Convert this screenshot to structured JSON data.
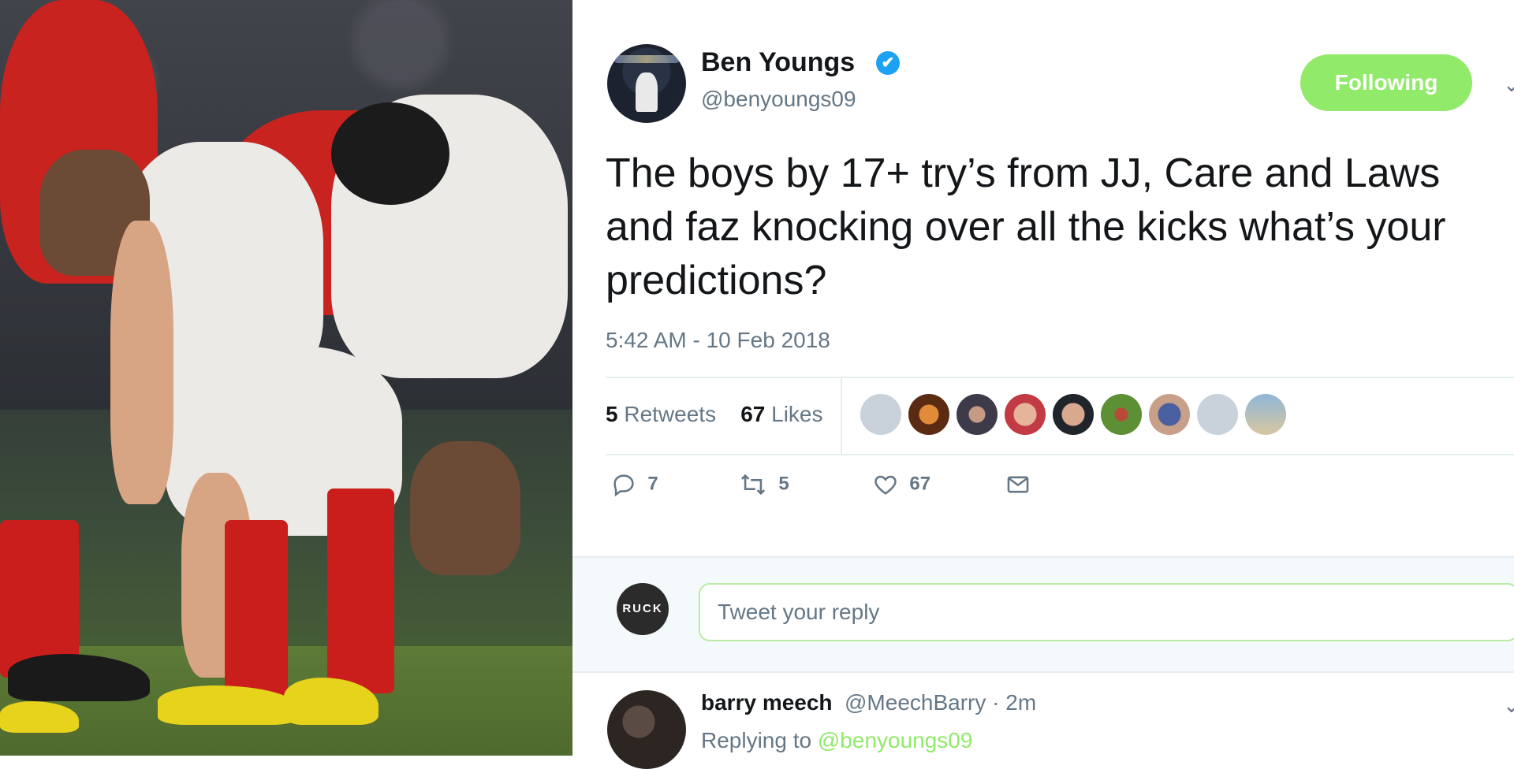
{
  "tweet": {
    "author_name": "Ben Youngs",
    "verified_mark": "✔",
    "handle": "@benyoungs09",
    "follow_button": "Following",
    "text": "The boys by 17+ try’s from JJ, Care and Laws and faz knocking over all the kicks what’s your predictions?",
    "timestamp": "5:42 AM - 10 Feb 2018",
    "retweets_count": "5",
    "retweets_label": "Retweets",
    "likes_count": "67",
    "likes_label": "Likes",
    "actions": {
      "reply_count": "7",
      "retweet_count": "5",
      "like_count": "67"
    }
  },
  "reply_box": {
    "avatar_text": "RUCK",
    "placeholder": "Tweet your reply"
  },
  "first_reply": {
    "name": "barry meech",
    "handle": "@MeechBarry · 2m",
    "replying_prefix": "Replying to",
    "replying_to": "@benyoungs09"
  },
  "colors": {
    "follow_green": "#91ea6a",
    "verified_blue": "#1da1f2",
    "muted_text": "#657786",
    "main_text": "#14171a"
  },
  "icons": [
    "verified-badge-icon",
    "chevron-down-icon",
    "reply-icon",
    "retweet-icon",
    "like-heart-icon",
    "direct-message-icon"
  ]
}
